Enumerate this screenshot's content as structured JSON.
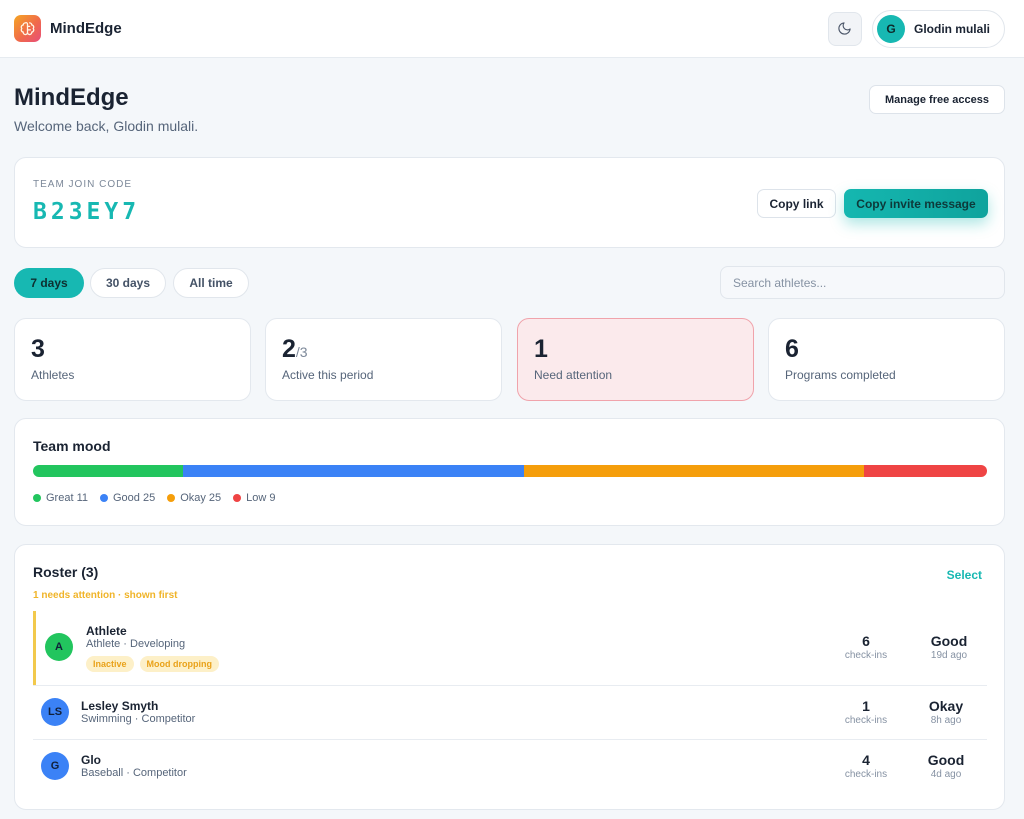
{
  "topbar": {
    "brand": "MindEdge",
    "user_initial": "G",
    "user_name": "Glodin mulali"
  },
  "header": {
    "title": "MindEdge",
    "welcome": "Welcome back, Glodin mulali.",
    "manage_label": "Manage free access"
  },
  "join": {
    "label": "TEAM JOIN CODE",
    "code": "B23EY7",
    "copy_link": "Copy link",
    "copy_invite": "Copy invite message"
  },
  "filters": {
    "items": [
      "7 days",
      "30 days",
      "All time"
    ],
    "active": "7 days",
    "search_placeholder": "Search athletes..."
  },
  "stats": [
    {
      "value": "3",
      "sub": "",
      "label": "Athletes"
    },
    {
      "value": "2",
      "sub": "/3",
      "label": "Active this period"
    },
    {
      "value": "1",
      "sub": "",
      "label": "Need attention"
    },
    {
      "value": "6",
      "sub": "",
      "label": "Programs completed"
    }
  ],
  "mood": {
    "title": "Team mood",
    "segments": [
      {
        "label": "Great",
        "value": 11,
        "color": "#22c55e"
      },
      {
        "label": "Good",
        "value": 25,
        "color": "#3b82f6"
      },
      {
        "label": "Okay",
        "value": 25,
        "color": "#f59e0b"
      },
      {
        "label": "Low",
        "value": 9,
        "color": "#ef4444"
      }
    ],
    "legend": [
      "Great 11",
      "Good 25",
      "Okay 25",
      "Low 9"
    ]
  },
  "roster": {
    "title": "Roster (3)",
    "select": "Select",
    "note": "1 needs attention · shown first",
    "rows": [
      {
        "initials": "A",
        "avatar_color": "#22c55e",
        "name": "Athlete",
        "meta": "Athlete · Developing",
        "tags": [
          "Inactive",
          "Mood dropping"
        ],
        "checkins": "6",
        "checkins_label": "check-ins",
        "mood": "Good",
        "ago": "19d ago"
      },
      {
        "initials": "LS",
        "avatar_color": "#3b82f6",
        "name": "Lesley Smyth",
        "meta": "Swimming · Competitor",
        "tags": [],
        "checkins": "1",
        "checkins_label": "check-ins",
        "mood": "Okay",
        "ago": "8h ago"
      },
      {
        "initials": "G",
        "avatar_color": "#3b82f6",
        "name": "Glo",
        "meta": "Baseball · Competitor",
        "tags": [],
        "checkins": "4",
        "checkins_label": "check-ins",
        "mood": "Good",
        "ago": "4d ago"
      }
    ]
  },
  "icons": {
    "logo": "brain-icon",
    "theme": "moon-icon"
  }
}
